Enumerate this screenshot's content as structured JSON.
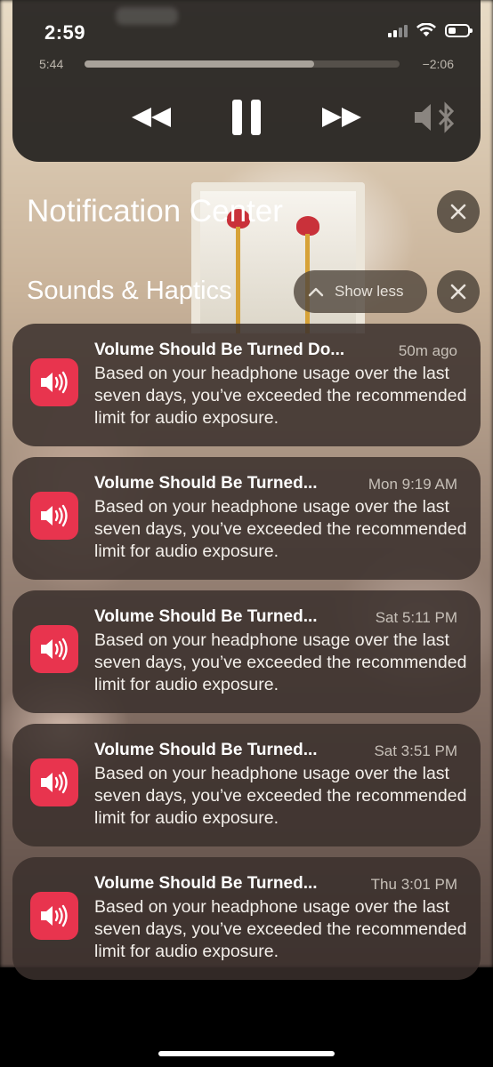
{
  "status_bar": {
    "time": "2:59"
  },
  "media": {
    "elapsed": "5:44",
    "remaining": "−2:06",
    "progress_fraction": 0.73,
    "controls": [
      "rewind-icon",
      "pause-icon",
      "fast-forward-icon",
      "bluetooth-speaker-icon"
    ]
  },
  "notification_center": {
    "title": "Notification Center",
    "group": {
      "title": "Sounds & Haptics",
      "show_less_label": "Show less"
    },
    "notifications": [
      {
        "title": "Volume Should Be Turned Do...",
        "time": "50m ago",
        "body": "Based on your headphone usage over the last seven days, you’ve exceeded the recommended limit for audio exposure."
      },
      {
        "title": "Volume Should Be Turned...",
        "time": "Mon 9:19 AM",
        "body": "Based on your headphone usage over the last seven days, you’ve exceeded the recommended limit for audio exposure."
      },
      {
        "title": "Volume Should Be Turned...",
        "time": "Sat 5:11 PM",
        "body": "Based on your headphone usage over the last seven days, you’ve exceeded the recommended limit for audio exposure."
      },
      {
        "title": "Volume Should Be Turned...",
        "time": "Sat 3:51 PM",
        "body": "Based on your headphone usage over the last seven days, you’ve exceeded the recommended limit for audio exposure."
      },
      {
        "title": "Volume Should Be Turned...",
        "time": "Thu 3:01 PM",
        "body": "Based on your headphone usage over the last seven days, you’ve exceeded the recommended limit for audio exposure."
      }
    ]
  },
  "colors": {
    "app_icon": "#e8344e",
    "card_background": "#3a302c"
  }
}
